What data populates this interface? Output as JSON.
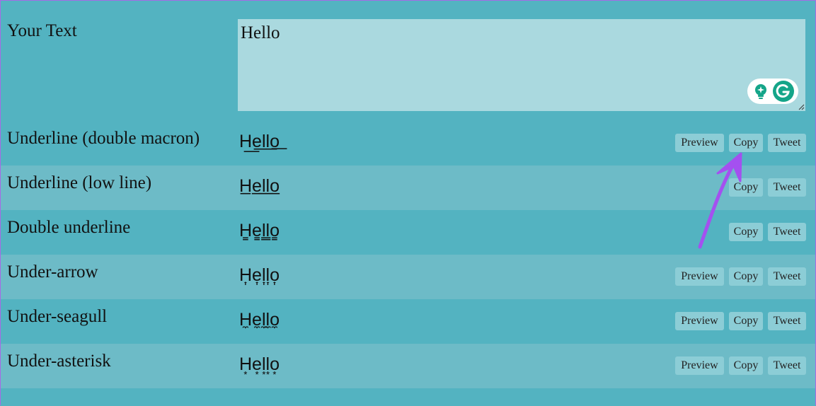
{
  "input": {
    "label": "Your Text",
    "value": "Hello"
  },
  "rows": [
    {
      "label": "Underline (double macron)",
      "preview": "H͟e͟l͟l͟o͟",
      "buttons": [
        "Preview",
        "Copy",
        "Tweet"
      ]
    },
    {
      "label": "Underline (low line)",
      "preview": "H̲e̲l̲l̲o̲",
      "buttons": [
        "Copy",
        "Tweet"
      ]
    },
    {
      "label": "Double underline",
      "preview": "H̳e̳l̳l̳o̳",
      "buttons": [
        "Copy",
        "Tweet"
      ]
    },
    {
      "label": "Under-arrow",
      "preview": "H͎e͎l͎l͎o͎",
      "buttons": [
        "Preview",
        "Copy",
        "Tweet"
      ]
    },
    {
      "label": "Under-seagull",
      "preview": "H̼e̼l̼l̼o̼",
      "buttons": [
        "Preview",
        "Copy",
        "Tweet"
      ]
    },
    {
      "label": "Under-asterisk",
      "preview": "H͙e͙l͙l͙o͙",
      "buttons": [
        "Preview",
        "Copy",
        "Tweet"
      ]
    }
  ],
  "buttons": {
    "preview": "Preview",
    "copy": "Copy",
    "tweet": "Tweet"
  },
  "colors": {
    "accent_arrow": "#a450f0",
    "row_dark": "#53b3c1",
    "row_light": "#6dbbc7",
    "textarea_bg": "#aad9df",
    "grammarly_green": "#15a589"
  },
  "icons": [
    "lightbulb-icon",
    "grammarly-icon",
    "resize-handle-icon",
    "arrow-annotation"
  ]
}
